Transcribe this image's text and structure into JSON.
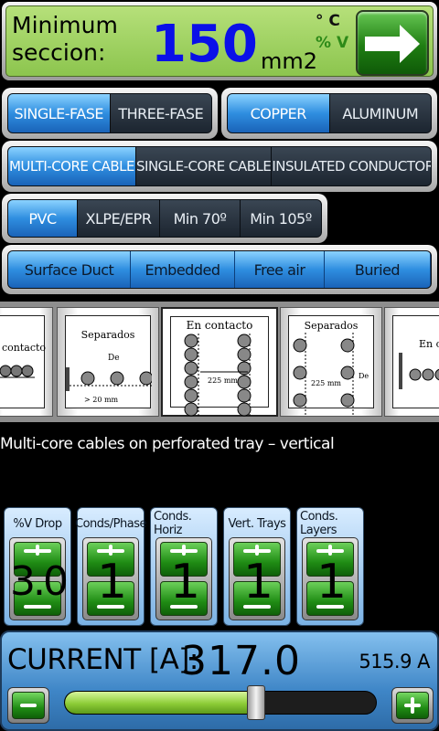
{
  "result": {
    "label_line1": "Minimum",
    "label_line2": "seccion:",
    "value": "150",
    "unit": "mm2",
    "unit_temp": "° C",
    "unit_drop": "% V",
    "next_icon": "arrow-right-icon"
  },
  "phase": {
    "options": [
      "SINGLE-FASE",
      "THREE-FASE"
    ],
    "selected": 0
  },
  "material": {
    "options": [
      "COPPER",
      "ALUMINUM"
    ],
    "selected": 0
  },
  "cable_type": {
    "options": [
      "MULTI-CORE CABLE",
      "SINGLE-CORE CABLE",
      "INSULATED CONDUCTOR"
    ],
    "selected": 0
  },
  "insulation": {
    "options": [
      "PVC",
      "XLPE/EPR",
      "Min 70º",
      "Min 105º"
    ],
    "selected": 0
  },
  "installation": {
    "options": [
      "Surface Duct",
      "Embedded",
      "Free air",
      "Buried"
    ]
  },
  "diagrams": {
    "cards": [
      {
        "caption": "contacto"
      },
      {
        "caption": "Separados",
        "dim1": "De",
        "dim2": "> 20 mm"
      },
      {
        "caption": "En contacto",
        "dim1": "225 mm"
      },
      {
        "caption": "Separados",
        "dim1": "225 mm",
        "dim2": "De"
      },
      {
        "caption": "En cont"
      }
    ],
    "selected_caption": "Multi-core cables on perforated tray – vertical"
  },
  "counters": [
    {
      "label": "%V Drop",
      "value": "3.0"
    },
    {
      "label": "Conds/Phase",
      "value": "1"
    },
    {
      "label": "Conds. Horiz",
      "value": "1"
    },
    {
      "label": "Vert. Trays",
      "value": "1"
    },
    {
      "label": "Conds. Layers",
      "value": "1"
    }
  ],
  "current": {
    "label": "CURRENT [A]:",
    "value": "317.0",
    "max": "515.9 A",
    "slider_fraction": 0.615
  },
  "colors": {
    "accent_blue": "#2f8ee0",
    "result_green": "#9ed35f",
    "value_blue": "#0a10e8",
    "button_green": "#1f8c14"
  }
}
